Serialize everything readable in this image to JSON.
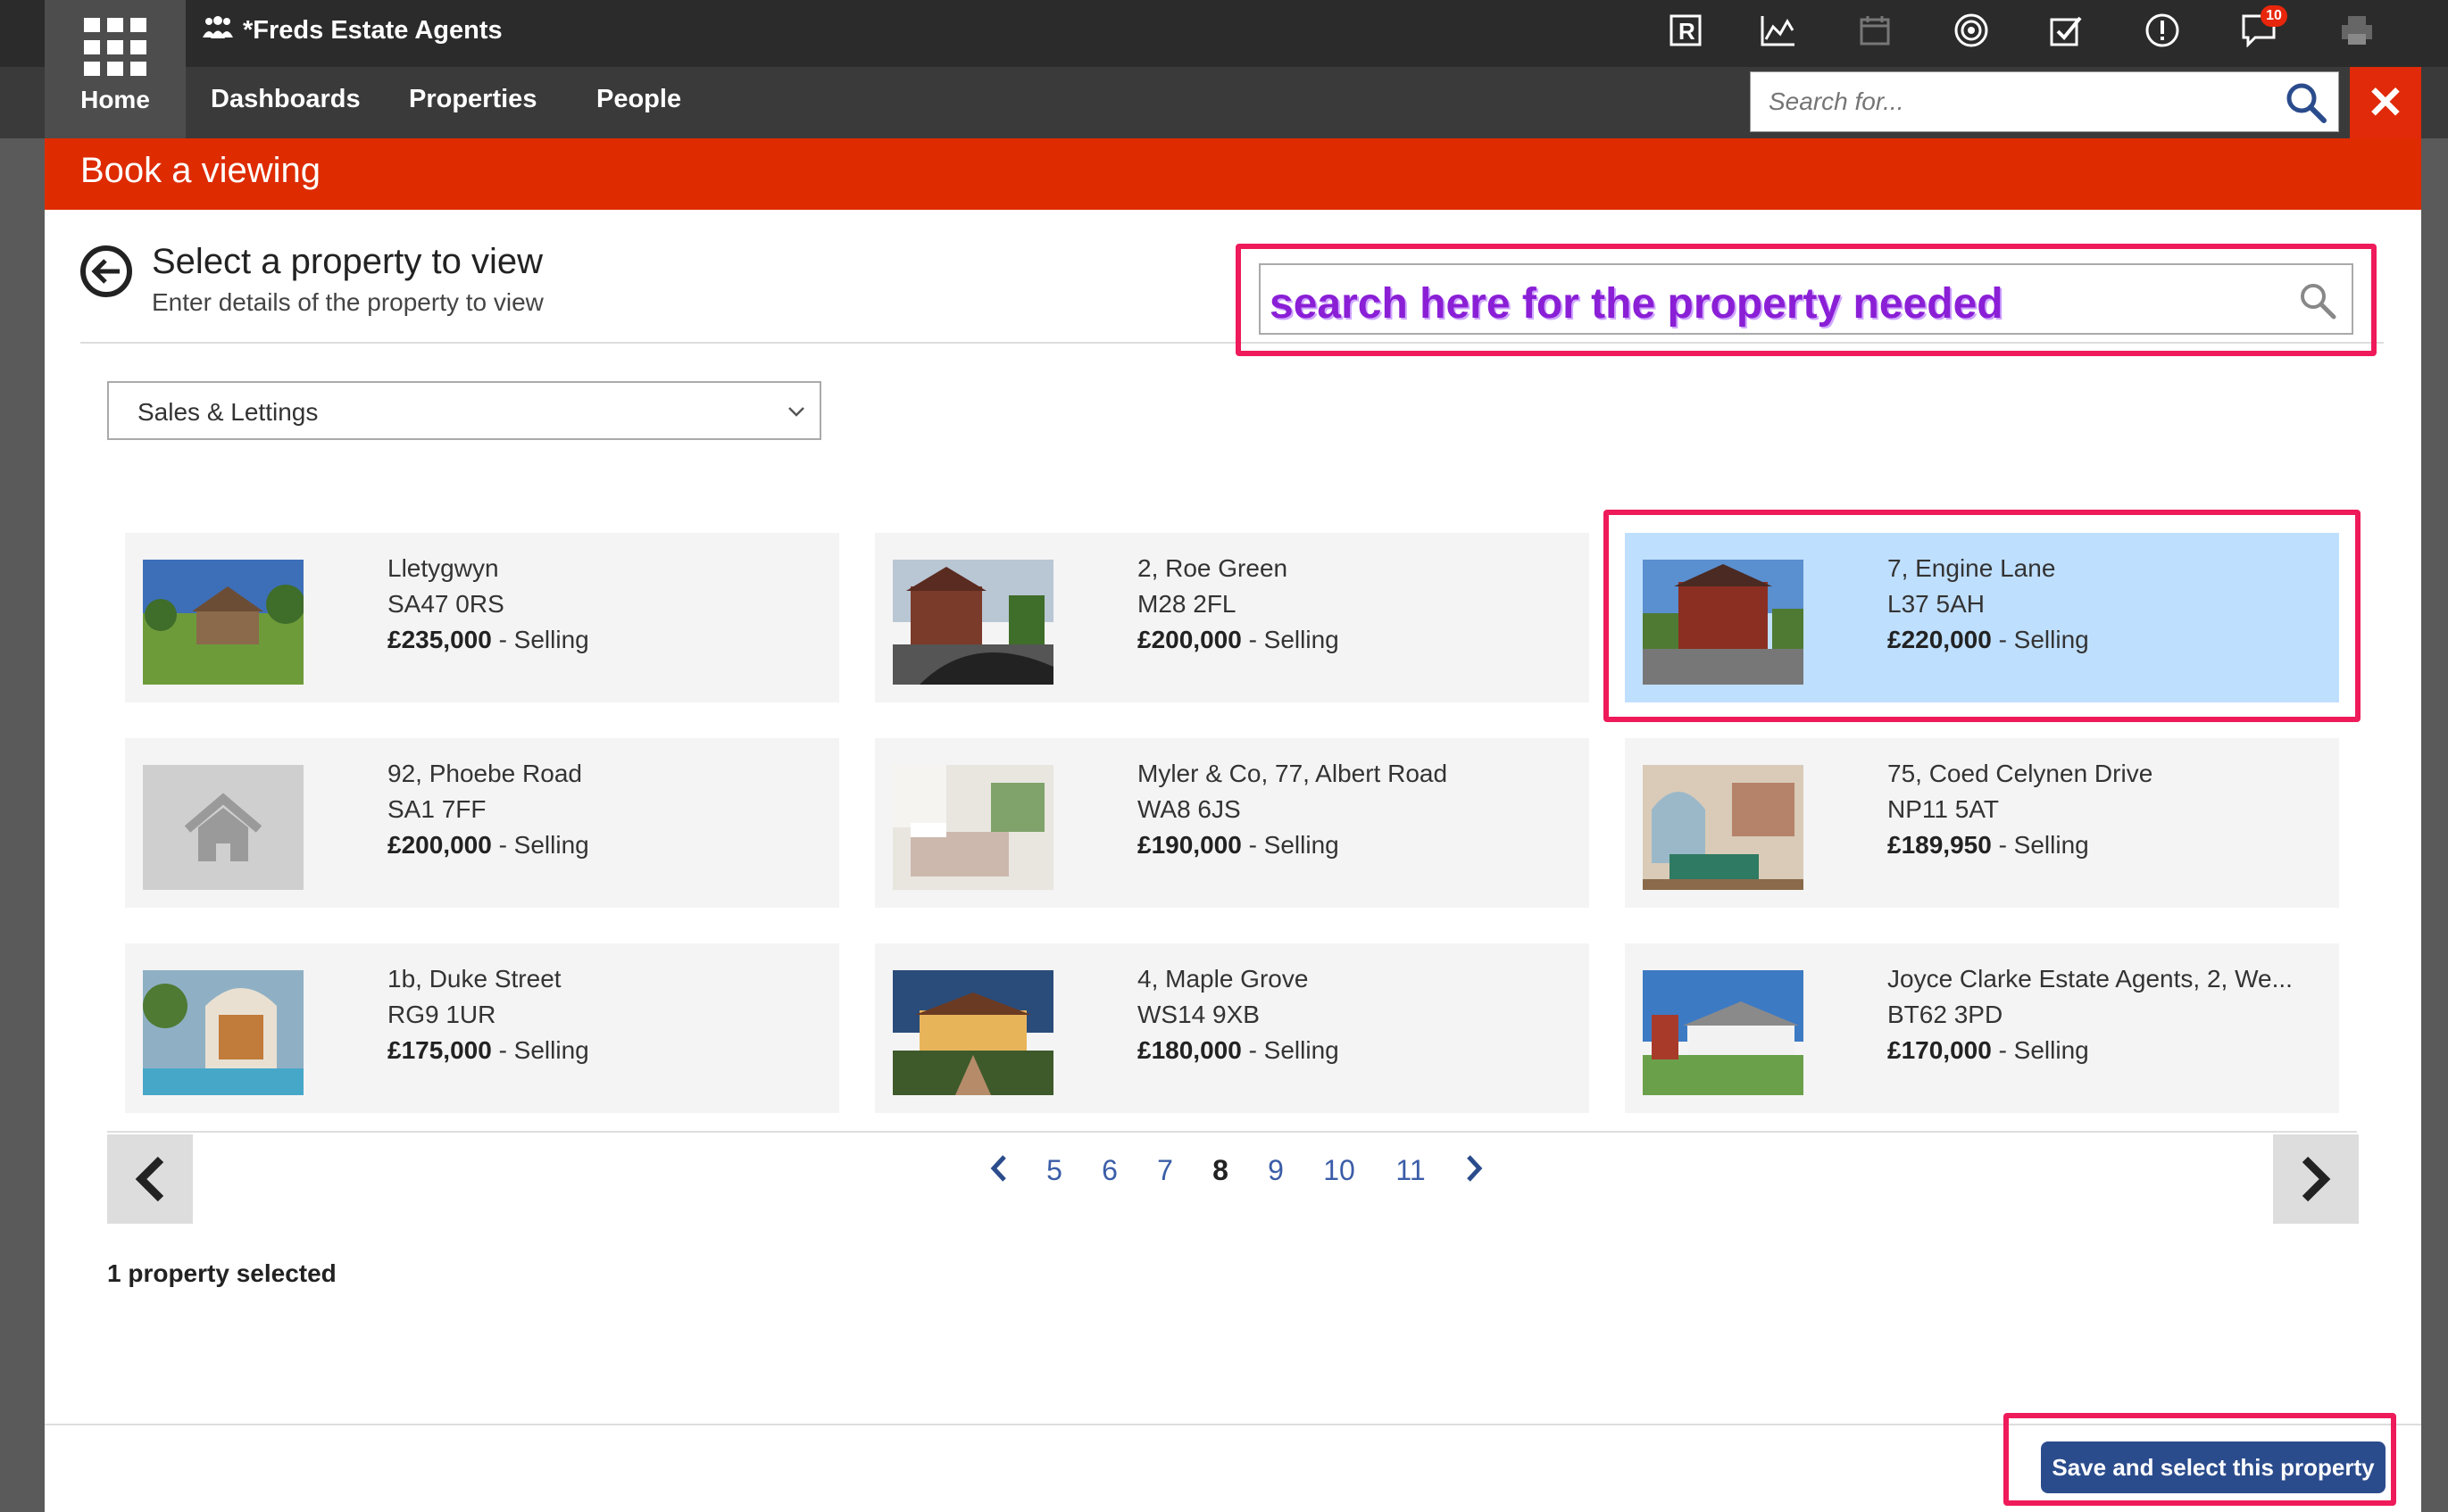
{
  "topbar": {
    "brand": "*Freds Estate Agents",
    "home_label": "Home",
    "nav": [
      "Dashboards",
      "Properties",
      "People"
    ],
    "notification_count": "10",
    "search_placeholder": "Search for..."
  },
  "modal": {
    "title": "Book a viewing",
    "heading": "Select a property to view",
    "subheading": "Enter details of the property to view",
    "search_annotation": "search here for the property needed",
    "filter_value": "Sales & Lettings",
    "selection_count": "1 property selected",
    "save_button": "Save and select this property"
  },
  "properties": [
    {
      "line1": "Lletygwyn",
      "line2": "SA47 0RS",
      "price": "£235,000",
      "status": " - Selling"
    },
    {
      "line1": "2, Roe Green",
      "line2": "M28 2FL",
      "price": "£200,000",
      "status": " - Selling"
    },
    {
      "line1": "7, Engine Lane",
      "line2": "L37 5AH",
      "price": "£220,000",
      "status": " - Selling"
    },
    {
      "line1": "92, Phoebe Road",
      "line2": "SA1 7FF",
      "price": "£200,000",
      "status": " - Selling"
    },
    {
      "line1": "Myler & Co, 77, Albert Road",
      "line2": "WA8 6JS",
      "price": "£190,000",
      "status": " - Selling"
    },
    {
      "line1": "75, Coed Celynen Drive",
      "line2": "NP11 5AT",
      "price": "£189,950",
      "status": " - Selling"
    },
    {
      "line1": "1b, Duke Street",
      "line2": "RG9 1UR",
      "price": "£175,000",
      "status": " - Selling"
    },
    {
      "line1": "4, Maple Grove",
      "line2": "WS14 9XB",
      "price": "£180,000",
      "status": " - Selling"
    },
    {
      "line1": "Joyce Clarke Estate Agents, 2, We...",
      "line2": "BT62 3PD",
      "price": "£170,000",
      "status": " - Selling"
    }
  ],
  "pagination": {
    "pages": [
      "5",
      "6",
      "7",
      "8",
      "9",
      "10",
      "11"
    ],
    "current": "8"
  },
  "colors": {
    "header_red": "#de2b00",
    "selected_card": "#bfdfff",
    "annotation_pink": "#ee1a5a",
    "button_blue": "#2b4c8c"
  }
}
